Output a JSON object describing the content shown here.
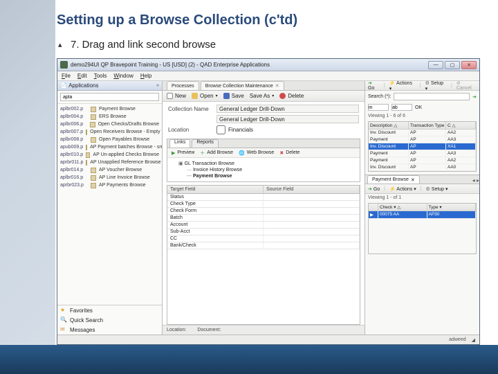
{
  "slide": {
    "title": "Setting up a Browse Collection (c'td)",
    "bullet": "7.  Drag and link second browse"
  },
  "window": {
    "title": "demo294UI QP Bravepoint Training - US [USD] (2) - QAD Enterprise Applications",
    "minimize": "—",
    "maximize": "▢",
    "close": "✕"
  },
  "menu": {
    "file": "File",
    "edit": "Edit",
    "tools": "Tools",
    "window": "Window",
    "help": "Help"
  },
  "applications": {
    "header": "Applications",
    "search_placeholder": "apla",
    "rows": [
      {
        "id": "aplbr002.p",
        "name": "Payment Browse"
      },
      {
        "id": "aplbr004.p",
        "name": "ERS Browse"
      },
      {
        "id": "aplbr006.p",
        "name": "Open Checks/Drafts Browse"
      },
      {
        "id": "aplbr007.p",
        "name": "Open Receivers Browse - Empty"
      },
      {
        "id": "aplbr008.p",
        "name": "Open  Payables Browse"
      },
      {
        "id": "apub009.p",
        "name": "AP Payment batches Browse - small"
      },
      {
        "id": "aplbr010.p",
        "name": "AP Un-applied Checks Browse"
      },
      {
        "id": "aprbr011.p",
        "name": "AP Unapplied Reference Browse"
      },
      {
        "id": "aplbr014.p",
        "name": "AP Voucher Browse"
      },
      {
        "id": "aplbr016.p",
        "name": "AP Line Invoice Browse"
      },
      {
        "id": "aprbr023.p",
        "name": "AP Payments Browse"
      }
    ],
    "fav": "Favorites",
    "qs": "Quick Search",
    "msg": "Messages"
  },
  "center": {
    "tabs": {
      "t1": "Processes",
      "t2": "Browse Collection Maintenance"
    },
    "toolbar": {
      "new": "New",
      "open": "Open",
      "save": "Save",
      "saveas": "Save As",
      "delete": "Delete"
    },
    "form": {
      "lbl_name": "Collection Name",
      "val_name": "General Ledger Drill-Down",
      "val_desc": "General Ledger Drill-Down",
      "lbl_loc": "Location",
      "chk_financials": "Financials"
    },
    "links": {
      "tab1": "Links",
      "tab2": "Reports",
      "preview": "Preview",
      "add": "Add Browse",
      "web": "Web Browse",
      "delete": "Delete",
      "root": "GL Transaction Browse",
      "n1": "Invoice History Browse",
      "n2": "Payment Browse"
    },
    "grid": {
      "h1": "Target Field",
      "h2": "Source Field",
      "rows": [
        "Status",
        "Check Type",
        "Check Form",
        "Batch",
        "Account",
        "Sub-Acct",
        "CC",
        "Bank/Check"
      ]
    },
    "foot": {
      "loc": "Location:",
      "doc": "Document:"
    }
  },
  "right": {
    "toolbar": {
      "go": "Go",
      "actions": "Actions",
      "setup": "Setup",
      "cancel": "Cancel"
    },
    "search_lbl": "Search (*):",
    "find_a": "in",
    "find_b": "ab",
    "ok": "OK",
    "view": "Viewing  1 - 6  of  6",
    "hdr": {
      "c1": "Description △",
      "c2": "Transaction Type △",
      "c3": "C △"
    },
    "rows": [
      {
        "c1": "Inv. Discount",
        "c2": "AP",
        "c3": "AA2"
      },
      {
        "c1": "Payment",
        "c2": "AP",
        "c3": "AA3"
      },
      {
        "c1": "Inv. Discount",
        "c2": "AP",
        "c3": "XA1",
        "sel": true
      },
      {
        "c1": "Payment",
        "c2": "AP",
        "c3": "AA3"
      },
      {
        "c1": "Payment",
        "c2": "AP",
        "c3": "AA2"
      },
      {
        "c1": "Inv. Discount",
        "c2": "AP",
        "c3": "AA0"
      }
    ],
    "panel2": {
      "tab": "Payment Browse",
      "view": "Viewing 1  -  of  1",
      "hdr": {
        "c1": "",
        "c2": "Check ▾ △",
        "c3": "Type ▾"
      },
      "row": {
        "c1": "▶",
        "c2": "00075 AA",
        "c3": "AP30"
      }
    }
  },
  "status": {
    "user": "adweed"
  }
}
